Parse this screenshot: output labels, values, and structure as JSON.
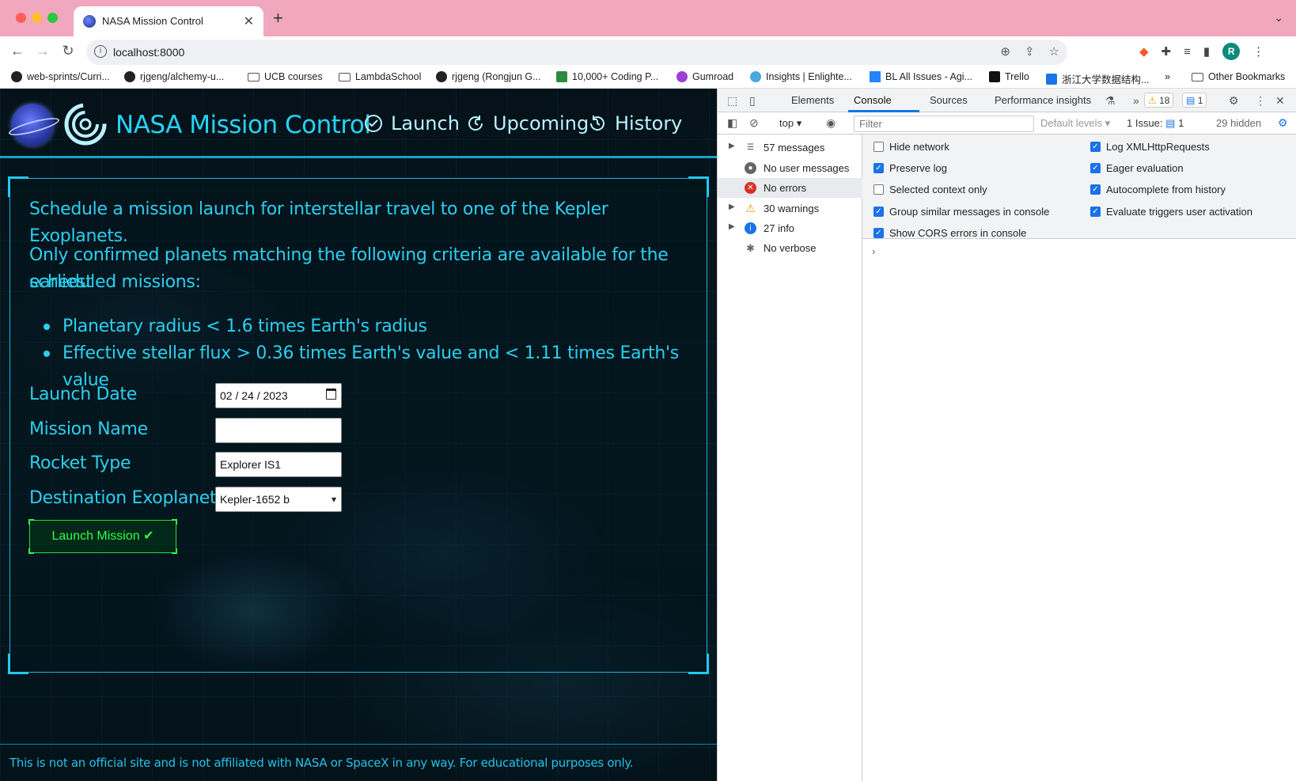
{
  "browser": {
    "tab_title": "NASA Mission Control",
    "url": "localhost:8000",
    "profile_initial": "R",
    "bookmarks": [
      "web-sprints/Curri...",
      "rjgeng/alchemy-u...",
      "UCB courses",
      "LambdaSchool",
      "rjgeng (Rongjun G...",
      "10,000+ Coding P...",
      "Gumroad",
      "Insights | Enlighte...",
      "BL All Issues - Agi...",
      "Trello",
      "浙江大学数据结构...",
      "Other Bookmarks"
    ]
  },
  "app": {
    "title": "NASA Mission Control",
    "nav": {
      "launch": "Launch",
      "upcoming": "Upcoming",
      "history": "History"
    },
    "intro": "Schedule a mission launch for interstellar travel to one of the Kepler Exoplanets.",
    "criteria_intro_line1": "Only confirmed planets matching the following criteria are available for the earliest",
    "criteria_intro_line2": "scheduled missions:",
    "criteria": [
      "Planetary radius < 1.6 times Earth's radius",
      "Effective stellar flux > 0.36 times Earth's value and < 1.11 times Earth's value"
    ],
    "form": {
      "launch_date_label": "Launch Date",
      "launch_date_value": "02 / 24 / 2023",
      "mission_name_label": "Mission Name",
      "mission_name_value": "",
      "rocket_type_label": "Rocket Type",
      "rocket_type_value": "Explorer IS1",
      "destination_label": "Destination Exoplanet",
      "destination_value": "Kepler-1652 b",
      "submit_label": "Launch Mission ✔"
    },
    "footer": "This is not an official site and is not affiliated with NASA or SpaceX in any way. For educational purposes only.",
    "colors": {
      "accent": "#26d3f6",
      "button": "#2bff4a"
    }
  },
  "devtools": {
    "tabs": [
      "Elements",
      "Console",
      "Sources",
      "Performance insights"
    ],
    "active_tab": "Console",
    "warnings_count": "18",
    "messages_count": "1",
    "context": "top",
    "filter_placeholder": "Filter",
    "levels": "Default levels",
    "issues_label": "1 Issue:",
    "issues_count": "1",
    "hidden": "29 hidden",
    "sidebar": [
      {
        "label": "57 messages",
        "icon": "list-icon"
      },
      {
        "label": "No user messages",
        "icon": "user-icon"
      },
      {
        "label": "No errors",
        "icon": "error-icon"
      },
      {
        "label": "30 warnings",
        "icon": "warning-icon"
      },
      {
        "label": "27 info",
        "icon": "info-icon"
      },
      {
        "label": "No verbose",
        "icon": "bug-icon"
      }
    ],
    "options_left": [
      {
        "label": "Hide network",
        "checked": false
      },
      {
        "label": "Preserve log",
        "checked": true
      },
      {
        "label": "Selected context only",
        "checked": false
      },
      {
        "label": "Group similar messages in console",
        "checked": true
      },
      {
        "label": "Show CORS errors in console",
        "checked": true
      }
    ],
    "options_right": [
      {
        "label": "Log XMLHttpRequests",
        "checked": true
      },
      {
        "label": "Eager evaluation",
        "checked": true
      },
      {
        "label": "Autocomplete from history",
        "checked": true
      },
      {
        "label": "Evaluate triggers user activation",
        "checked": true
      }
    ]
  }
}
